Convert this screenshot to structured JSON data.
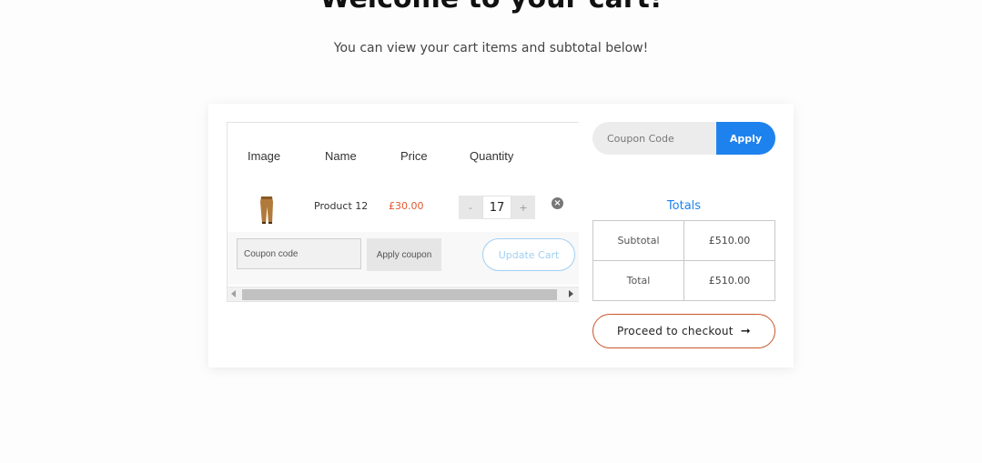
{
  "hero": {
    "title": "Welcome to your cart!",
    "subtitle": "You can view your cart items and subtotal below!"
  },
  "cart_table": {
    "headers": [
      "Image",
      "Name",
      "Price",
      "Quantity"
    ],
    "items": [
      {
        "name": "Product 12",
        "price": "£30.00",
        "quantity": "17",
        "image": "trousers-product-image"
      }
    ],
    "stepper": {
      "minus": "-",
      "plus": "+"
    },
    "remove_icon": "remove-circle-x-icon"
  },
  "actions": {
    "coupon_placeholder": "Coupon code",
    "apply_coupon_label": "Apply coupon",
    "update_cart_label": "Update Cart"
  },
  "coupon_box": {
    "placeholder": "Coupon Code",
    "apply_label": "Apply"
  },
  "totals": {
    "title": "Totals",
    "rows": [
      {
        "label": "Subtotal",
        "value": "£510.00"
      },
      {
        "label": "Total",
        "value": "£510.00"
      }
    ]
  },
  "checkout": {
    "label": "Proceed to checkout",
    "icon": "arrow-right-icon"
  },
  "colors": {
    "accent_blue": "#1e82ee",
    "price_orange": "#e2592e",
    "checkout_border": "#c9562a"
  }
}
